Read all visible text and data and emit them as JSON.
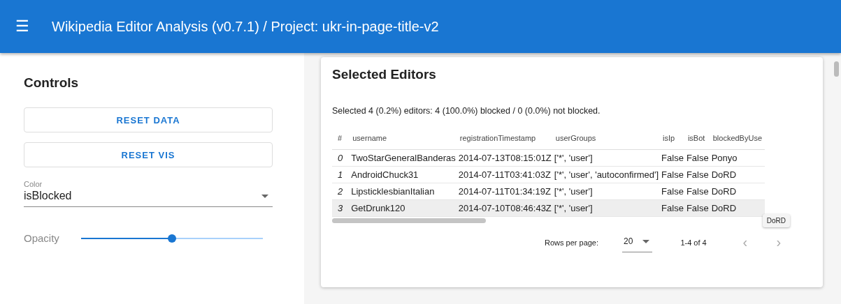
{
  "app_bar": {
    "menu_icon": "☰",
    "title": "Wikipedia Editor Analysis (v0.7.1) / Project: ukr-in-page-title-v2"
  },
  "controls": {
    "title": "Controls",
    "buttons": [
      "RESET DATA",
      "RESET VIS"
    ],
    "color_select": {
      "label": "Color",
      "value": "isBlocked"
    },
    "opacity": {
      "label": "Opacity",
      "level": 0.5
    }
  },
  "selected_editors": {
    "title": "Selected Editors",
    "summary": "Selected 4 (0.2%) editors: 4 (100.0%) blocked / 0 (0.0%) not blocked.",
    "table": {
      "columns": [
        "#",
        "username",
        "registrationTimestamp",
        "userGroups",
        "isIp",
        "isBot",
        "blockedByUse"
      ],
      "rows": [
        {
          "selected": false,
          "cells": [
            "0",
            "TwoStarGeneralBanderas",
            "2014-07-13T08:15:01Z",
            "['*', 'user']",
            "False",
            "False",
            "Ponyo"
          ]
        },
        {
          "selected": false,
          "cells": [
            "1",
            "AndroidChuck31",
            "2014-07-11T03:41:03Z",
            "['*', 'user', 'autoconfirmed']",
            "False",
            "False",
            "DoRD"
          ]
        },
        {
          "selected": false,
          "cells": [
            "2",
            "LipsticklesbianItalian",
            "2014-07-11T01:34:19Z",
            "['*', 'user']",
            "False",
            "False",
            "DoRD"
          ]
        },
        {
          "selected": true,
          "cells": [
            "3",
            "GetDrunk120",
            "2014-07-10T08:46:43Z",
            "['*', 'user']",
            "False",
            "False",
            "DoRD"
          ]
        }
      ]
    },
    "footer": {
      "rows_per_page_label": "Rows per page:",
      "rows_per_page": "20",
      "range": "1-4 of 4",
      "prev": "‹",
      "next": "›"
    },
    "tooltip": "DoRD"
  }
}
